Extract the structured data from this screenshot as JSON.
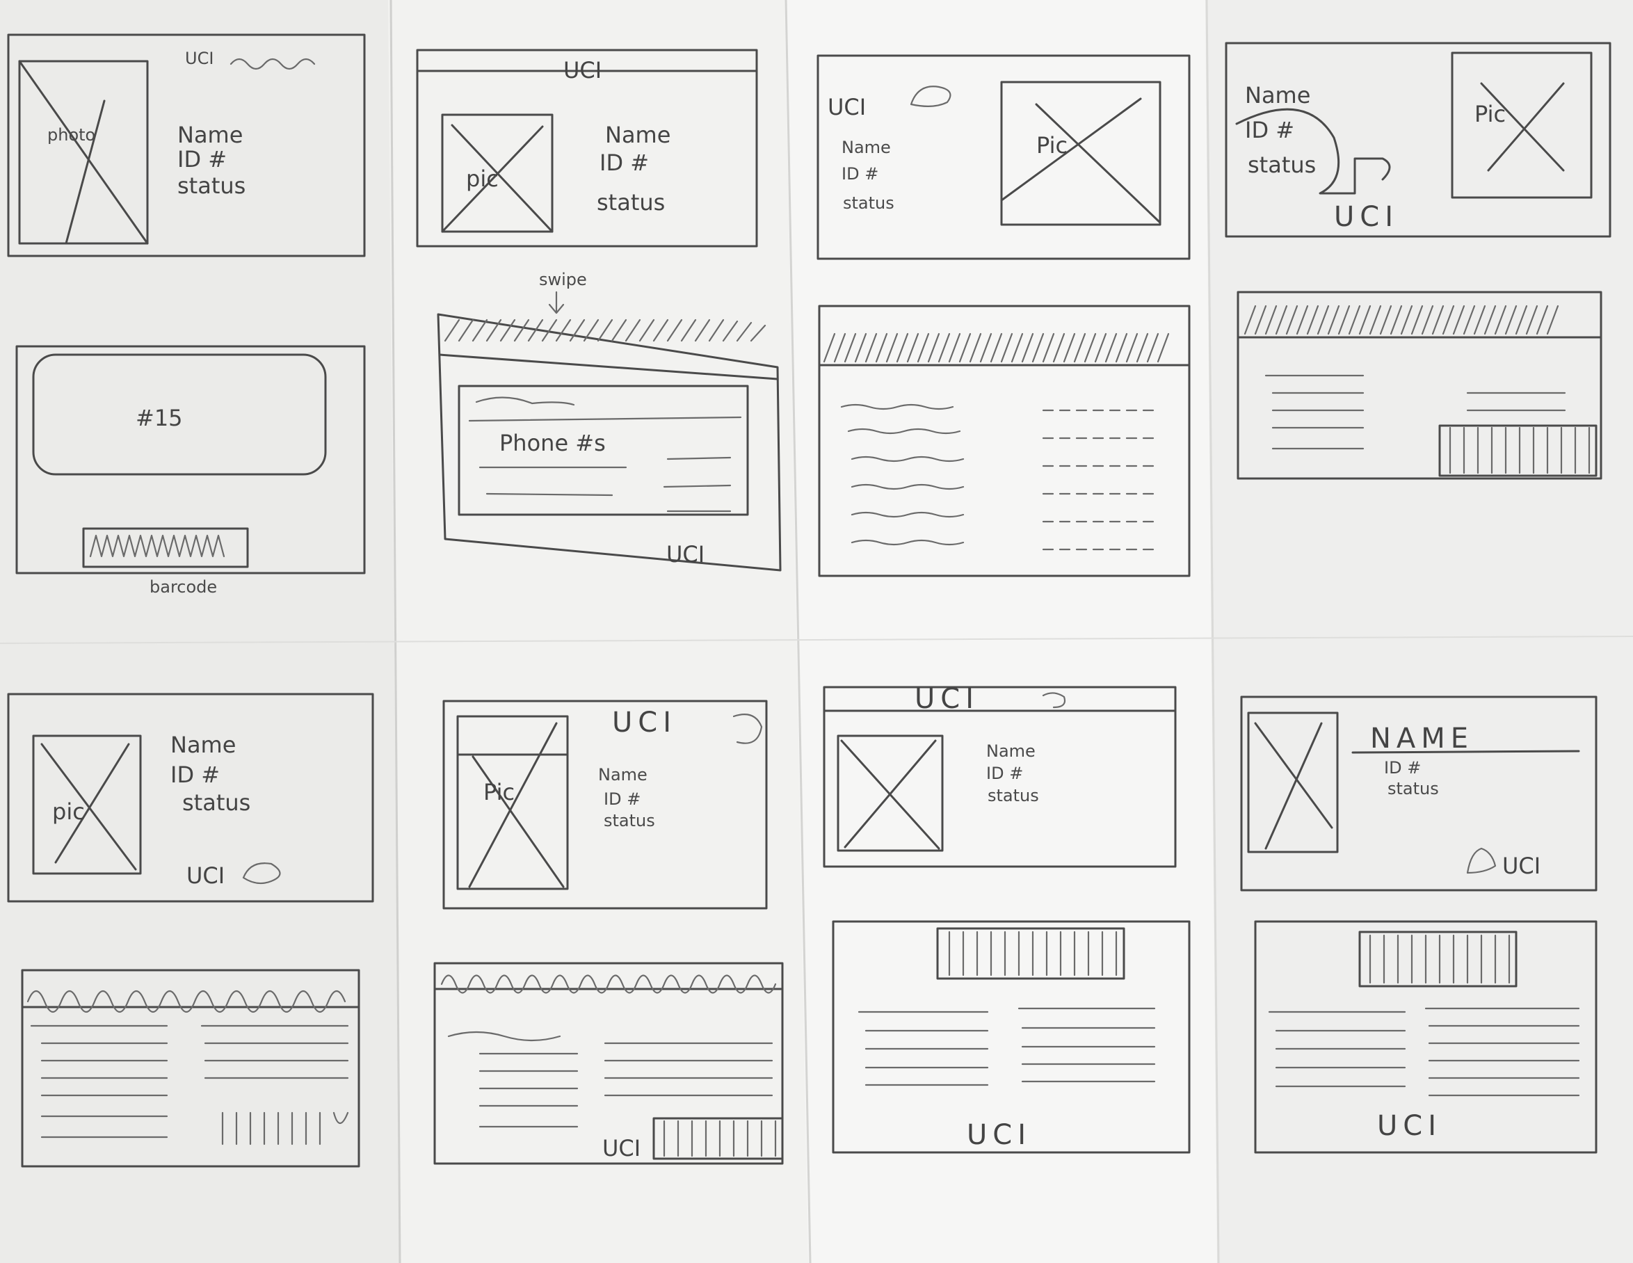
{
  "sketches": {
    "s1": {
      "logo": "UCI",
      "pic": "photo",
      "name": "Name",
      "id": "ID #",
      "status": "status"
    },
    "s2": {
      "logo": "UCI",
      "pic": "pic",
      "name": "Name",
      "id": "ID #",
      "status": "status"
    },
    "s3": {
      "logo": "UCI",
      "pic": "Pic",
      "name": "Name",
      "id": "ID #",
      "status": "status"
    },
    "s4": {
      "logo": "UCI",
      "pic": "Pic",
      "name": "Name",
      "id": "ID #",
      "status": "status"
    },
    "s5": {
      "number": "#15",
      "barcode_label": "barcode"
    },
    "s6": {
      "annotation": "swipe",
      "phone": "Phone #s",
      "logo": "UCI"
    },
    "s9": {
      "logo": "UCI",
      "pic": "pic",
      "name": "Name",
      "id": "ID #",
      "status": "status"
    },
    "s10": {
      "logo": "UCI",
      "pic": "Pic",
      "name": "Name",
      "id": "ID #",
      "status": "status"
    },
    "s11": {
      "logo": "UCI",
      "name": "Name",
      "id": "ID #",
      "status": "status"
    },
    "s12": {
      "logo": "UCI",
      "name": "NAME",
      "id": "ID #",
      "status": "status"
    },
    "s14": {
      "logo": "UCI"
    },
    "s15": {
      "logo": "UCI"
    },
    "s16": {
      "logo": "UCI"
    }
  }
}
